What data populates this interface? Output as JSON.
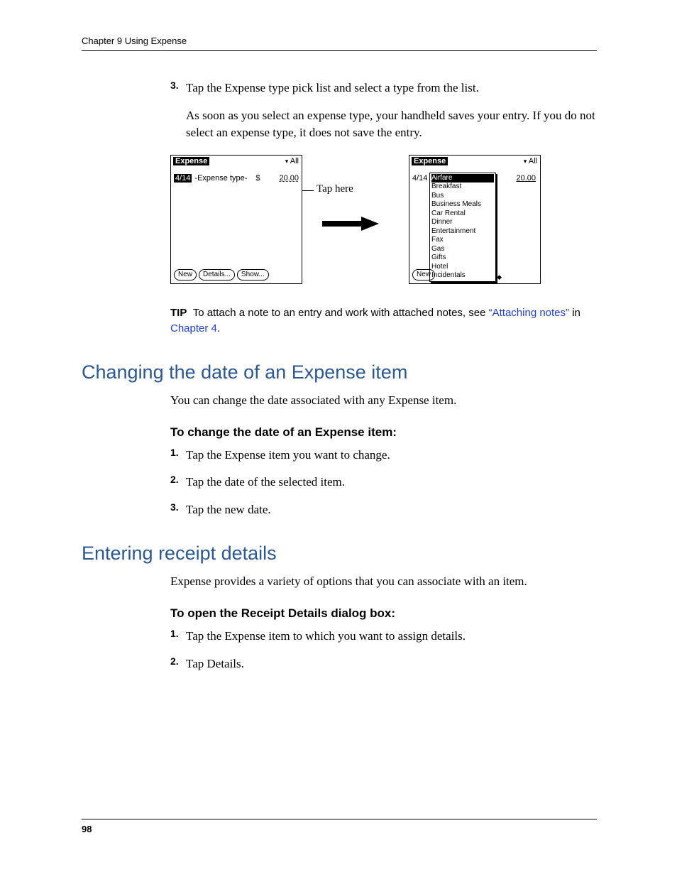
{
  "runhead": "Chapter 9   Using Expense",
  "page_number": "98",
  "step3": {
    "num": "3.",
    "text": "Tap the Expense type pick list and select a type from the list.",
    "follow": "As soon as you select an expense type, your handheld saves your entry. If you do not select an expense type, it does not save the entry."
  },
  "fig": {
    "left_title": "Expense",
    "right_title": "Expense",
    "all_label": "All",
    "date": "4/14",
    "picktype": "-Expense type-",
    "currency": "$",
    "amount": "20.00",
    "btn_new": "New",
    "btn_details": "Details...",
    "btn_show": "Show...",
    "callout": "Tap here",
    "popup_selected": "Airfare",
    "popup_items": [
      "Breakfast",
      "Bus",
      "Business Meals",
      "Car Rental",
      "Dinner",
      "Entertainment",
      "Fax",
      "Gas",
      "Gifts",
      "Hotel",
      "Incidentals"
    ]
  },
  "tip": {
    "label": "TIP",
    "pre": "To attach a note to an entry and work with attached notes, see ",
    "link1": "“Attaching notes”",
    "mid": " in ",
    "link2": "Chapter 4",
    "post": "."
  },
  "sec1": {
    "title": "Changing the date of an Expense item",
    "intro": "You can change the date associated with any Expense item.",
    "proc_title": "To change the date of an Expense item:",
    "steps": [
      {
        "n": "1.",
        "t": "Tap the Expense item you want to change."
      },
      {
        "n": "2.",
        "t": "Tap the date of the selected item."
      },
      {
        "n": "3.",
        "t": "Tap the new date."
      }
    ]
  },
  "sec2": {
    "title": "Entering receipt details",
    "intro": "Expense provides a variety of options that you can associate with an item.",
    "proc_title": "To open the Receipt Details dialog box:",
    "steps": [
      {
        "n": "1.",
        "t": "Tap the Expense item to which you want to assign details."
      },
      {
        "n": "2.",
        "t": "Tap Details."
      }
    ]
  }
}
